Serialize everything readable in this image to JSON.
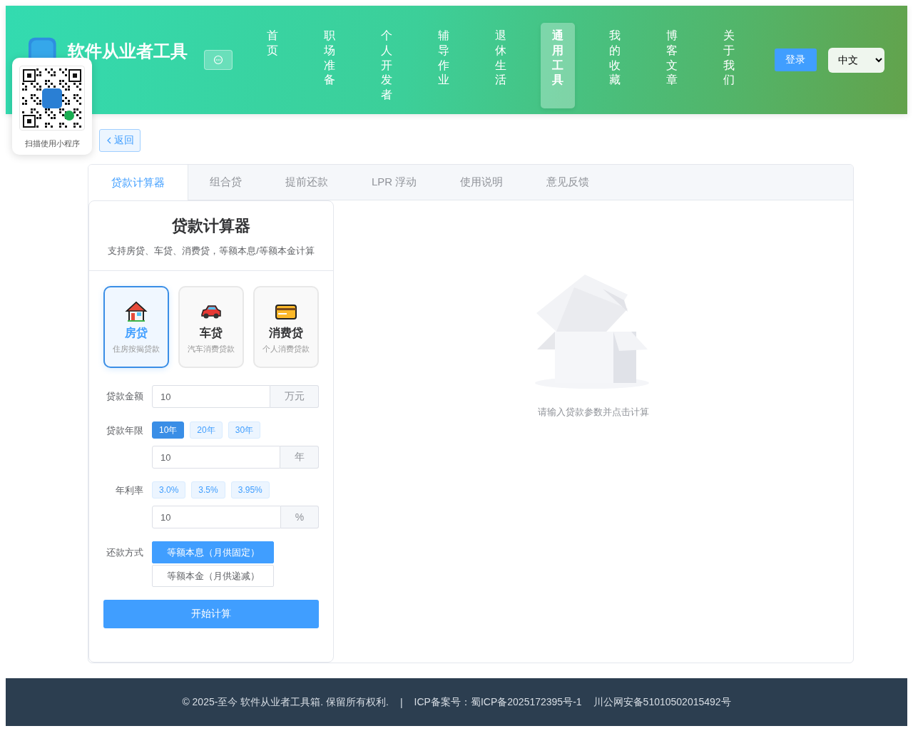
{
  "site": {
    "title": "软件从业者工具"
  },
  "nav": [
    {
      "label": "首页",
      "selected": false
    },
    {
      "label": "职场准备",
      "selected": false
    },
    {
      "label": "个人开发者",
      "selected": false
    },
    {
      "label": "辅导作业",
      "selected": false
    },
    {
      "label": "退休生活",
      "selected": false
    },
    {
      "label": "通用工具",
      "selected": true
    },
    {
      "label": "我的收藏",
      "selected": false
    },
    {
      "label": "博客文章",
      "selected": false
    },
    {
      "label": "关于我们",
      "selected": false
    }
  ],
  "login_button": "登录",
  "language_select": {
    "value": "中文"
  },
  "qr_popup": {
    "caption": "扫描使用小程序"
  },
  "back_button": "返回",
  "tabs": [
    {
      "label": "贷款计算器",
      "selected": true
    },
    {
      "label": "组合贷",
      "selected": false
    },
    {
      "label": "提前还款",
      "selected": false
    },
    {
      "label": "LPR 浮动",
      "selected": false
    },
    {
      "label": "使用说明",
      "selected": false
    },
    {
      "label": "意见反馈",
      "selected": false
    }
  ],
  "calculator": {
    "title": "贷款计算器",
    "subtitle": "支持房贷、车贷、消费贷，等额本息/等额本金计算",
    "loan_types": [
      {
        "kind": "house",
        "name": "房贷",
        "description": "住房按揭贷款",
        "selected": true
      },
      {
        "kind": "car",
        "name": "车贷",
        "description": "汽车消费贷款",
        "selected": false
      },
      {
        "kind": "card",
        "name": "消费贷",
        "description": "个人消费贷款",
        "selected": false
      }
    ],
    "amount": {
      "label": "贷款金额",
      "value": "10",
      "unit": "万元"
    },
    "term": {
      "label": "贷款年限",
      "presets": [
        {
          "label": "10年",
          "selected": true
        },
        {
          "label": "20年",
          "selected": false
        },
        {
          "label": "30年",
          "selected": false
        }
      ],
      "value": "10",
      "unit": "年"
    },
    "rate": {
      "label": "年利率",
      "presets": [
        {
          "label": "3.0%",
          "selected": false
        },
        {
          "label": "3.5%",
          "selected": false
        },
        {
          "label": "3.95%",
          "selected": false
        }
      ],
      "value": "10",
      "unit": "%"
    },
    "repayment": {
      "label": "还款方式",
      "options": [
        {
          "label": "等额本息（月供固定）",
          "selected": true
        },
        {
          "label": "等额本金（月供递减）",
          "selected": false
        }
      ]
    },
    "submit_button": "开始计算"
  },
  "result": {
    "empty_text": "请输入贷款参数并点击计算"
  },
  "footer": {
    "copyright": "© 2025-至今 软件从业者工具箱. 保留所有权利.",
    "separator": "|",
    "icp": "ICP备案号：蜀ICP备2025172395号-1",
    "police": "川公网安备51010502015492号"
  }
}
